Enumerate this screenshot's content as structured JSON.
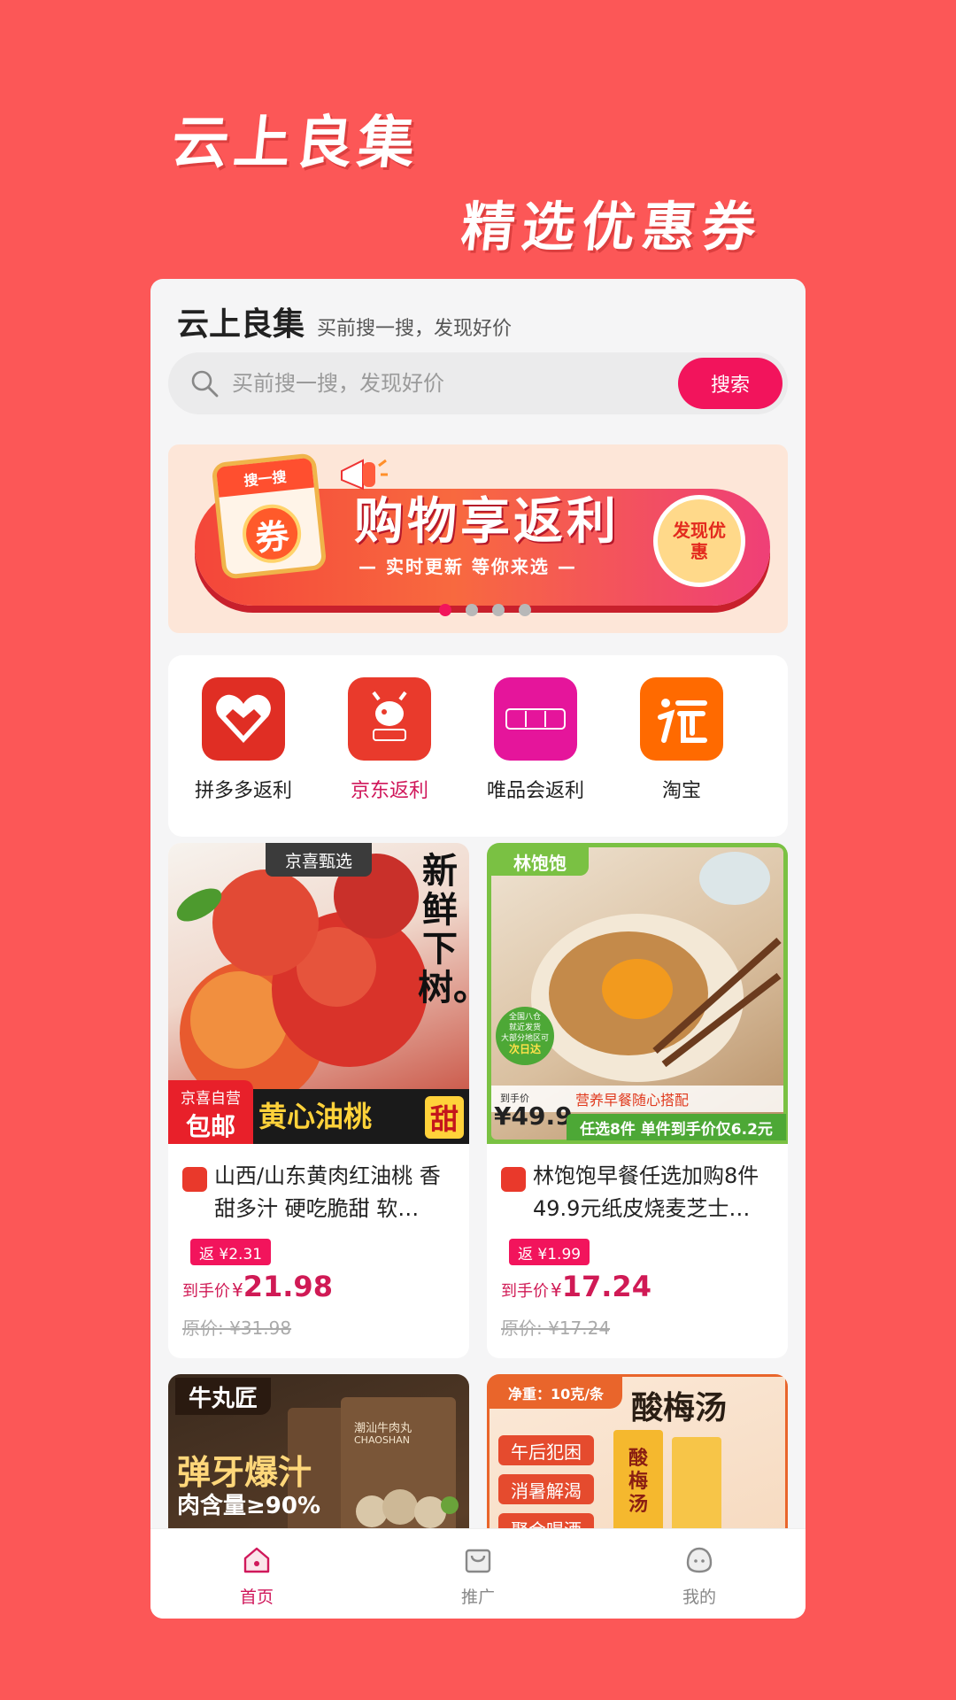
{
  "promo": {
    "title": "云上良集",
    "subtitle": "精选优惠券"
  },
  "app": {
    "title": "云上良集",
    "slogan": "买前搜一搜，发现好价"
  },
  "search": {
    "placeholder": "买前搜一搜，发现好价",
    "value": "",
    "button_label": "搜索"
  },
  "banner": {
    "coupon_top": "搜一搜",
    "coupon_char": "券",
    "headline": "购物享返利",
    "sub": "— 实时更新 等你来选 —",
    "badge": "发现优惠",
    "active_dot": 0,
    "dot_count": 4
  },
  "platforms": [
    {
      "label": "拼多多返利",
      "icon": "pinduoduo-icon",
      "color": "#e02e24",
      "active": false
    },
    {
      "label": "京东返利",
      "icon": "jd-icon",
      "color": "#e93a2c",
      "active": true
    },
    {
      "label": "唯品会返利",
      "icon": "vipshop-icon",
      "color": "#e5159b",
      "active": false
    },
    {
      "label": "淘宝",
      "icon": "taobao-icon",
      "color": "#ff6a00",
      "active": false
    }
  ],
  "products": [
    {
      "title": "山西/山东黄肉红油桃 香甜多汁 硬吃脆甜 软…",
      "rebate": "返 ¥2.31",
      "price_label": "到手价",
      "currency": "¥",
      "price": "21.98",
      "original_price": "原价: ¥31.98",
      "image": {
        "tag": "京喜甄选",
        "side_text": "新鲜下树。",
        "bottom_text": "黄心油桃",
        "bottom_accent": "甜",
        "corner_top": "京喜自营",
        "corner_bottom": "包邮"
      }
    },
    {
      "title": "林饱饱早餐任选加购8件 49.9元纸皮烧麦芝士…",
      "rebate": "返 ¥1.99",
      "price_label": "到手价",
      "currency": "¥",
      "price": "17.24",
      "original_price": "原价: ¥17.24",
      "image": {
        "brand": "林饱饱",
        "badge_line1": "全国八仓",
        "badge_line2": "就近发货",
        "badge_line3": "大部分地区可",
        "badge_line4": "次日达",
        "strip_label": "到手价",
        "strip_price": "¥49.9",
        "strip_text": "营养早餐随心搭配",
        "bottom_text": "任选8件 单件到手价仅6.2元"
      }
    },
    {
      "image": {
        "brand": "牛丸匠",
        "pack_text": "潮汕牛肉丸",
        "pack_en": "CHAOSHAN",
        "headline": "弹牙爆汁",
        "sub": "肉含量≥90%"
      }
    },
    {
      "image": {
        "tag": "净重：10克/条",
        "headline": "酸梅汤",
        "chip1": "午后犯困",
        "chip2": "消暑解渴",
        "chip3": "聚会喝酒",
        "pack_text": "酸梅汤"
      }
    }
  ],
  "tabbar": [
    {
      "label": "首页",
      "icon": "home-icon",
      "active": true
    },
    {
      "label": "推广",
      "icon": "bag-icon",
      "active": false
    },
    {
      "label": "我的",
      "icon": "profile-icon",
      "active": false
    }
  ],
  "colors": {
    "background": "#fc5757",
    "accent": "#f2145c",
    "price": "#d01a55"
  }
}
